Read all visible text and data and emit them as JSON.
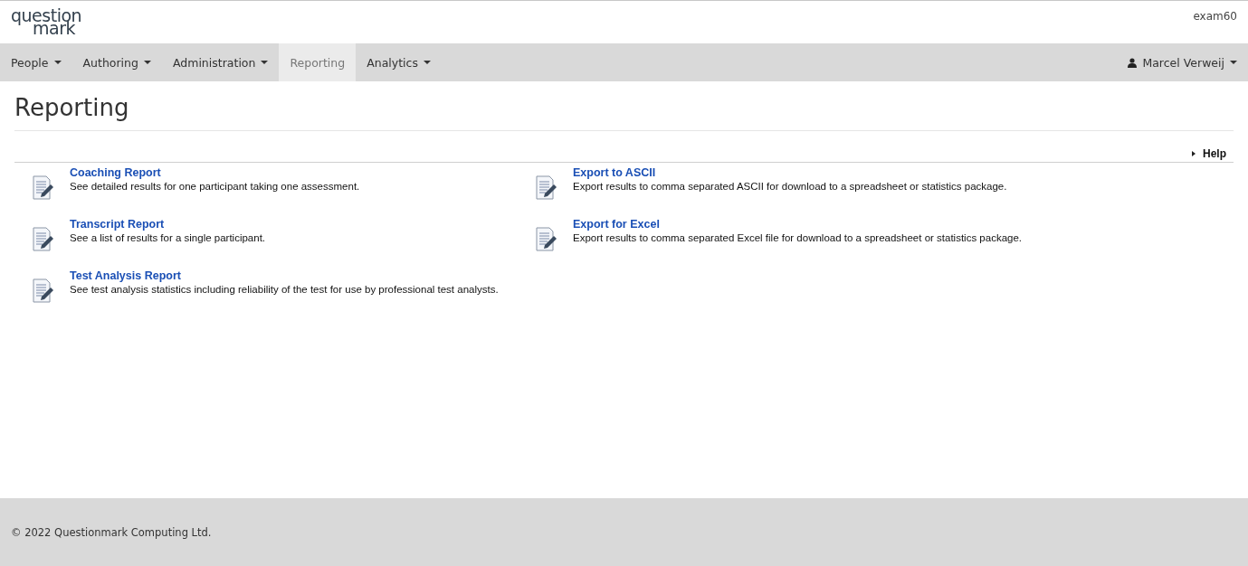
{
  "header": {
    "logo": [
      "question",
      "mark"
    ],
    "site": "exam60"
  },
  "nav": {
    "items": [
      {
        "label": "People",
        "dropdown": true,
        "selected": false
      },
      {
        "label": "Authoring",
        "dropdown": true,
        "selected": false
      },
      {
        "label": "Administration",
        "dropdown": true,
        "selected": false
      },
      {
        "label": "Reporting",
        "dropdown": false,
        "selected": true
      },
      {
        "label": "Analytics",
        "dropdown": true,
        "selected": false
      }
    ],
    "user": {
      "name": "Marcel Verweij",
      "dropdown": true
    }
  },
  "page": {
    "title": "Reporting",
    "help": "Help"
  },
  "columns": [
    [
      {
        "title": "Coaching Report",
        "description": "See detailed results for one participant taking one assessment."
      },
      {
        "title": "Transcript Report",
        "description": "See a list of results for a single participant."
      },
      {
        "title": "Test Analysis Report",
        "description": "See test analysis statistics including reliability of the test for use by professional test analysts."
      }
    ],
    [
      {
        "title": "Export to ASCII",
        "description": "Export results to comma separated ASCII for download to a spreadsheet or statistics package."
      },
      {
        "title": "Export for Excel",
        "description": "Export results to comma separated Excel file for download to a spreadsheet or statistics package."
      }
    ]
  ],
  "footer": "© 2022 Questionmark Computing Ltd."
}
